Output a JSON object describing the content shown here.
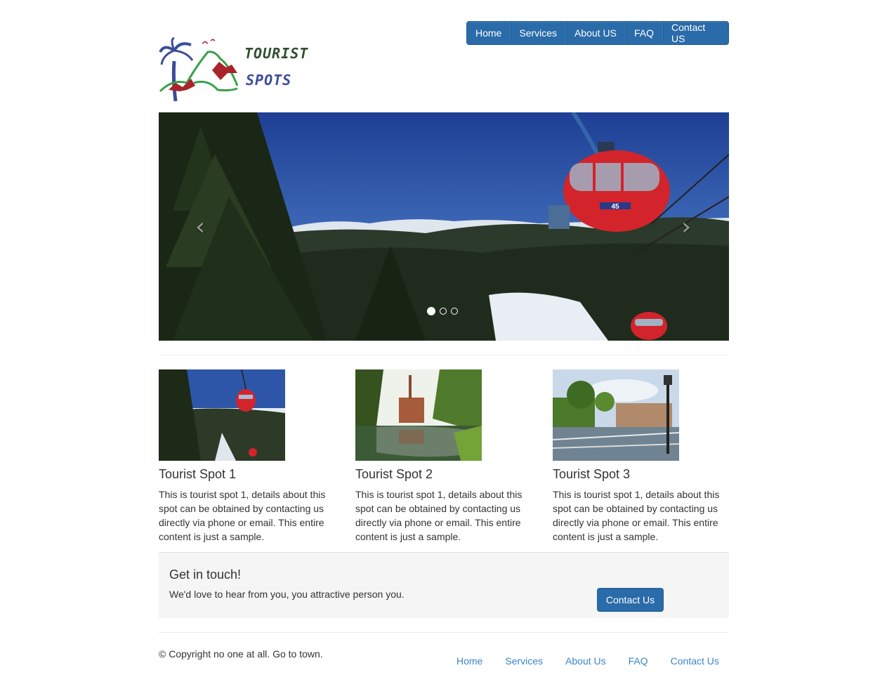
{
  "nav": {
    "items": [
      {
        "label": "Home"
      },
      {
        "label": "Services"
      },
      {
        "label": "About US"
      },
      {
        "label": "FAQ"
      },
      {
        "label": "Contact US"
      }
    ]
  },
  "logo": {
    "line1": "TOURIST",
    "line2": "SPOTS"
  },
  "carousel": {
    "cabin_number": "45",
    "prev_icon": "chevron-left-icon",
    "next_icon": "chevron-right-icon",
    "slide_count": 3,
    "active_slide": 1
  },
  "spots": [
    {
      "title": "Tourist Spot 1",
      "text": "This is tourist spot 1, details about this spot can be obtained by contacting us directly via phone or email. This entire content is just a sample."
    },
    {
      "title": "Tourist Spot 2",
      "text": "This is tourist spot 1, details about this spot can be obtained by contacting us directly via phone or email. This entire content is just a sample."
    },
    {
      "title": "Tourist Spot 3",
      "text": "This is tourist spot 1, details about this spot can be obtained by contacting us directly via phone or email. This entire content is just a sample."
    }
  ],
  "contact": {
    "heading": "Get in touch!",
    "text": "We'd love to hear from you, you attractive person you.",
    "button_label": "Contact Us"
  },
  "footer": {
    "copyright": "© Copyright no one at all. Go to town.",
    "links": [
      {
        "label": "Home"
      },
      {
        "label": "Services"
      },
      {
        "label": "About Us"
      },
      {
        "label": "FAQ"
      },
      {
        "label": "Contact Us"
      }
    ]
  },
  "colors": {
    "primary": "#2a6ba9",
    "link": "#3a86c8",
    "well": "#f5f5f5"
  }
}
